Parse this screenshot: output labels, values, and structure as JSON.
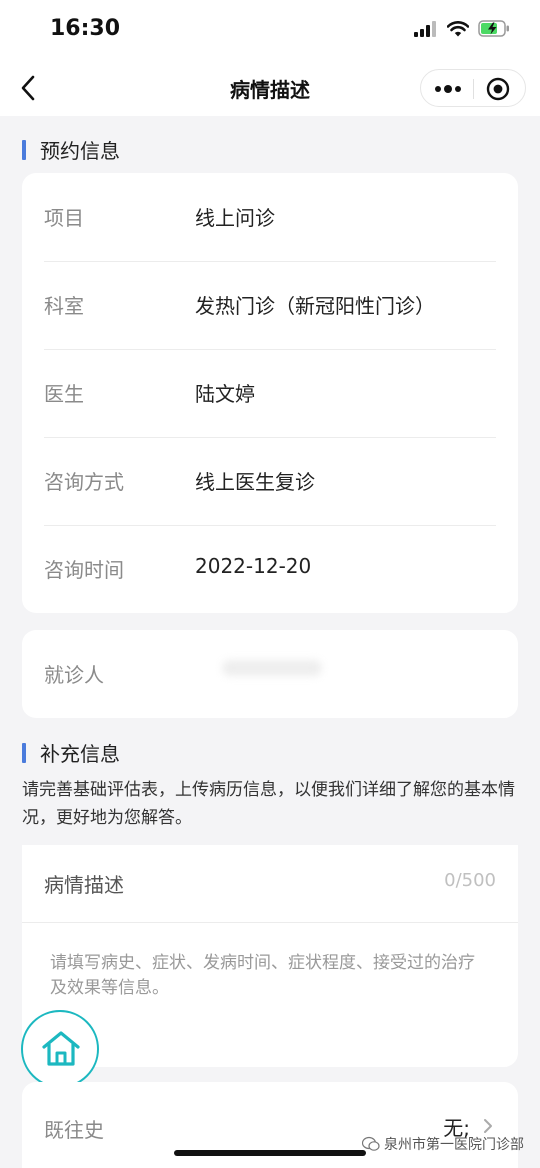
{
  "status_bar": {
    "time": "16:30",
    "icons": [
      "signal-icon",
      "wifi-icon",
      "battery-charging-icon"
    ]
  },
  "nav": {
    "title": "病情描述",
    "back_icon": "chevron-left-icon",
    "more_icon": "more-dots-icon",
    "close_icon": "target-circle-icon"
  },
  "appointment": {
    "heading": "预约信息",
    "rows": [
      {
        "label": "项目",
        "value": "线上问诊"
      },
      {
        "label": "科室",
        "value": "发热门诊（新冠阳性门诊）"
      },
      {
        "label": "医生",
        "value": "陆文婷"
      },
      {
        "label": "咨询方式",
        "value": "线上医生复诊"
      },
      {
        "label": "咨询时间",
        "value": "2022-12-20"
      }
    ],
    "patient_label": "就诊人"
  },
  "supplement": {
    "heading": "补充信息",
    "description": "请完善基础评估表，上传病历信息，以便我们详细了解您的基本情况，更好地为您解答。",
    "condition": {
      "label": "病情描述",
      "counter": "0/500",
      "placeholder": "请填写病史、症状、发病时间、症状程度、接受过的治疗及效果等信息。"
    },
    "history": {
      "label": "既往史",
      "value": "无;"
    }
  },
  "watermark": "泉州市第一医院门诊部",
  "colors": {
    "accent_bar": "#4a7bdc",
    "home_fab": "#1cb8c0"
  }
}
